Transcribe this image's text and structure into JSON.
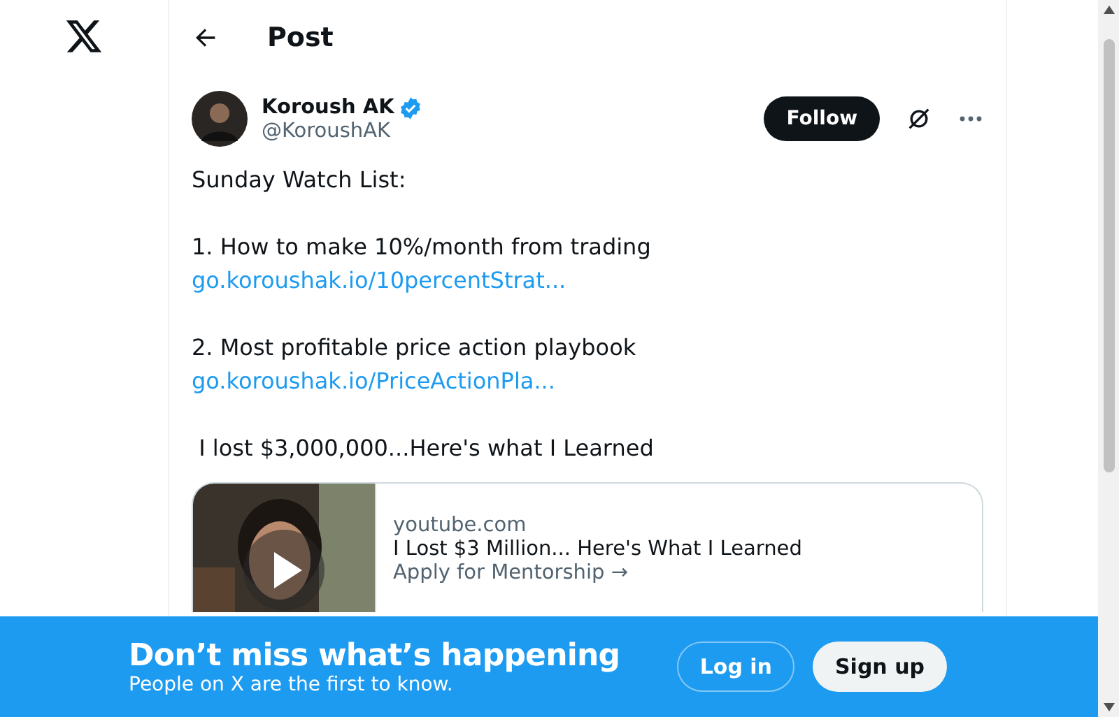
{
  "header": {
    "title": "Post"
  },
  "author": {
    "name": "Koroush AK",
    "verified": true,
    "handle": "@KoroushAK"
  },
  "follow_button": "Follow",
  "post_lines": [
    {
      "kind": "text",
      "text": "Sunday Watch List:"
    },
    {
      "kind": "gap"
    },
    {
      "kind": "text",
      "text": "1. How to make 10%/month from trading"
    },
    {
      "kind": "link",
      "text": "go.koroushak.io/10percentStrat..."
    },
    {
      "kind": "gap"
    },
    {
      "kind": "text",
      "text": "2. Most profitable price action playbook"
    },
    {
      "kind": "link",
      "text": "go.koroushak.io/PriceActionPla..."
    },
    {
      "kind": "gap"
    },
    {
      "kind": "text",
      "text": " I lost $3,000,000...Here's what I Learned"
    }
  ],
  "link_card": {
    "domain": "youtube.com",
    "title": "I Lost $3 Million... Here's What I Learned",
    "description": "Apply for Mentorship →"
  },
  "banner": {
    "title": "Don’t miss what’s happening",
    "subtitle": "People on X are the first to know.",
    "login": "Log in",
    "signup": "Sign up"
  }
}
